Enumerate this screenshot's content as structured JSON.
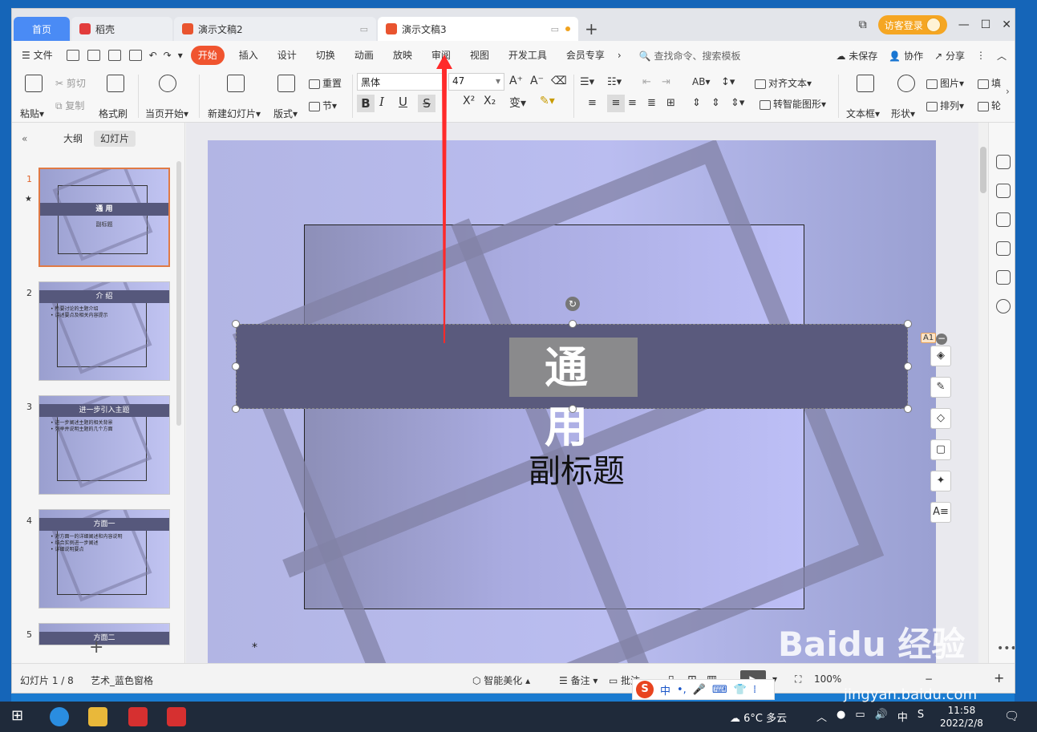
{
  "tabs": [
    {
      "label": "首页"
    },
    {
      "label": "稻壳"
    },
    {
      "label": "演示文稿2"
    },
    {
      "label": "演示文稿3"
    }
  ],
  "window": {
    "login": "访客登录"
  },
  "menu": {
    "file": "文件",
    "items": [
      "开始",
      "插入",
      "设计",
      "切换",
      "动画",
      "放映",
      "审阅",
      "视图",
      "开发工具",
      "会员专享"
    ],
    "search": "查找命令、搜索模板",
    "unsaved": "未保存",
    "collab": "协作",
    "share": "分享"
  },
  "ribbon": {
    "paste": "粘贴",
    "cut": "剪切",
    "copy": "复制",
    "format_painter": "格式刷",
    "play_from_current": "当页开始",
    "new_slide": "新建幻灯片",
    "layout": "版式",
    "reset": "重置",
    "section": "节",
    "font_name": "黑体",
    "font_size": "47",
    "align_text": "对齐文本",
    "smart_shape": "转智能图形",
    "textbox": "文本框",
    "shape": "形状",
    "picture": "图片",
    "arrange": "排列",
    "fill": "填",
    "outline": "轮"
  },
  "panel": {
    "outline_tab": "大纲",
    "slides_tab": "幻灯片",
    "slides": [
      {
        "num": "1",
        "title": "通 用",
        "subtitle": "副标题",
        "bullets": []
      },
      {
        "num": "2",
        "title": "介 绍",
        "subtitle": "",
        "bullets": [
          "• 所要讨论的主题介绍",
          "• 讲述要点及相关内容提示"
        ]
      },
      {
        "num": "3",
        "title": "进一步引入主题",
        "subtitle": "",
        "bullets": [
          "• 进一步阐述主题的相关背景",
          "• 列举并说明主题的几个方面"
        ]
      },
      {
        "num": "4",
        "title": "方面一",
        "subtitle": "",
        "bullets": [
          "• 对方面一的详细阐述和内容说明",
          "• 结合实例进一步阐述",
          "• 详细说明要点"
        ]
      },
      {
        "num": "5",
        "title": "方面二",
        "subtitle": "",
        "bullets": []
      }
    ]
  },
  "slide": {
    "title": "通 用",
    "subtitle": "副标题",
    "asterisk": "*",
    "badge": "A1"
  },
  "status": {
    "slide_count": "幻灯片 1 / 8",
    "theme": "艺术_蓝色窗格",
    "beautify": "智能美化",
    "notes": "备注",
    "comments": "批注",
    "zoom": "100%"
  },
  "ime": {
    "mode": "中"
  },
  "taskbar": {
    "weather": "6°C 多云",
    "lang": "中",
    "time": "11:58",
    "date": "2022/2/8"
  },
  "watermark": {
    "brand": "Baidu 经验",
    "url": "jingyan.baidu.com"
  },
  "colors": {
    "accent": "#f0542f",
    "tab_home": "#4a8bf5",
    "title_bar": "#5a5a7d",
    "arrow": "#ff2a2a"
  }
}
